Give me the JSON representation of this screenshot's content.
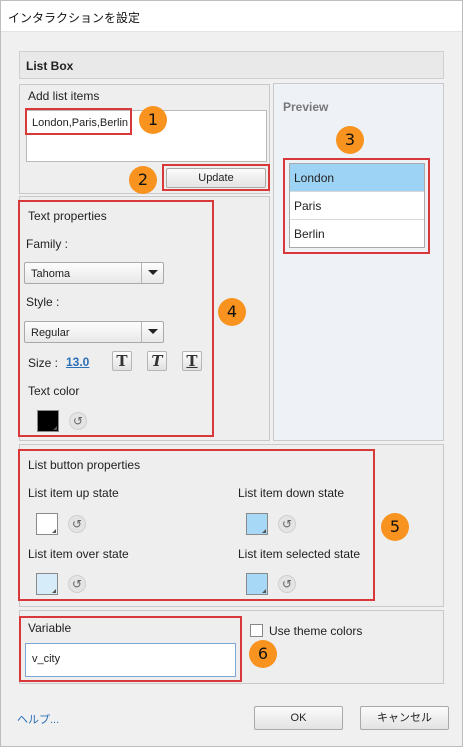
{
  "window": {
    "title": "インタラクションを設定"
  },
  "heading": "List Box",
  "add_list": {
    "title": "Add list items",
    "items_text": "London,Paris,Berlin",
    "update_label": "Update"
  },
  "preview": {
    "title": "Preview",
    "items": [
      "London",
      "Paris",
      "Berlin"
    ],
    "selected_index": 0
  },
  "text_props": {
    "title": "Text properties",
    "family_label": "Family :",
    "family_value": "Tahoma",
    "style_label": "Style :",
    "style_value": "Regular",
    "size_label": "Size :",
    "size_value": "13.0",
    "format_glyphs": [
      "T",
      "T",
      "T"
    ],
    "color_label": "Text color",
    "color_value": "#000000"
  },
  "list_button": {
    "title": "List button properties",
    "up_label": "List item up state",
    "down_label": "List item down state",
    "over_label": "List item over state",
    "selected_label": "List item selected state",
    "colors": {
      "up": "#ffffff",
      "down": "#a7d8f6",
      "over": "#d6ecf8",
      "selected": "#a7d8f6"
    }
  },
  "variable": {
    "title": "Variable",
    "value": "v_city",
    "theme_label": "Use theme colors"
  },
  "badges": [
    "1",
    "2",
    "3",
    "4",
    "5",
    "6"
  ],
  "footer": {
    "help": "ヘルプ...",
    "ok": "OK",
    "cancel": "キャンセル"
  },
  "colors": {
    "highlight": "#d9383a",
    "badge": "#f7931e",
    "selected_row": "#9dd3f5",
    "link": "#2a6fb8"
  },
  "icons": {
    "reset": "reset-icon",
    "dropdown": "chevron-down-icon"
  }
}
